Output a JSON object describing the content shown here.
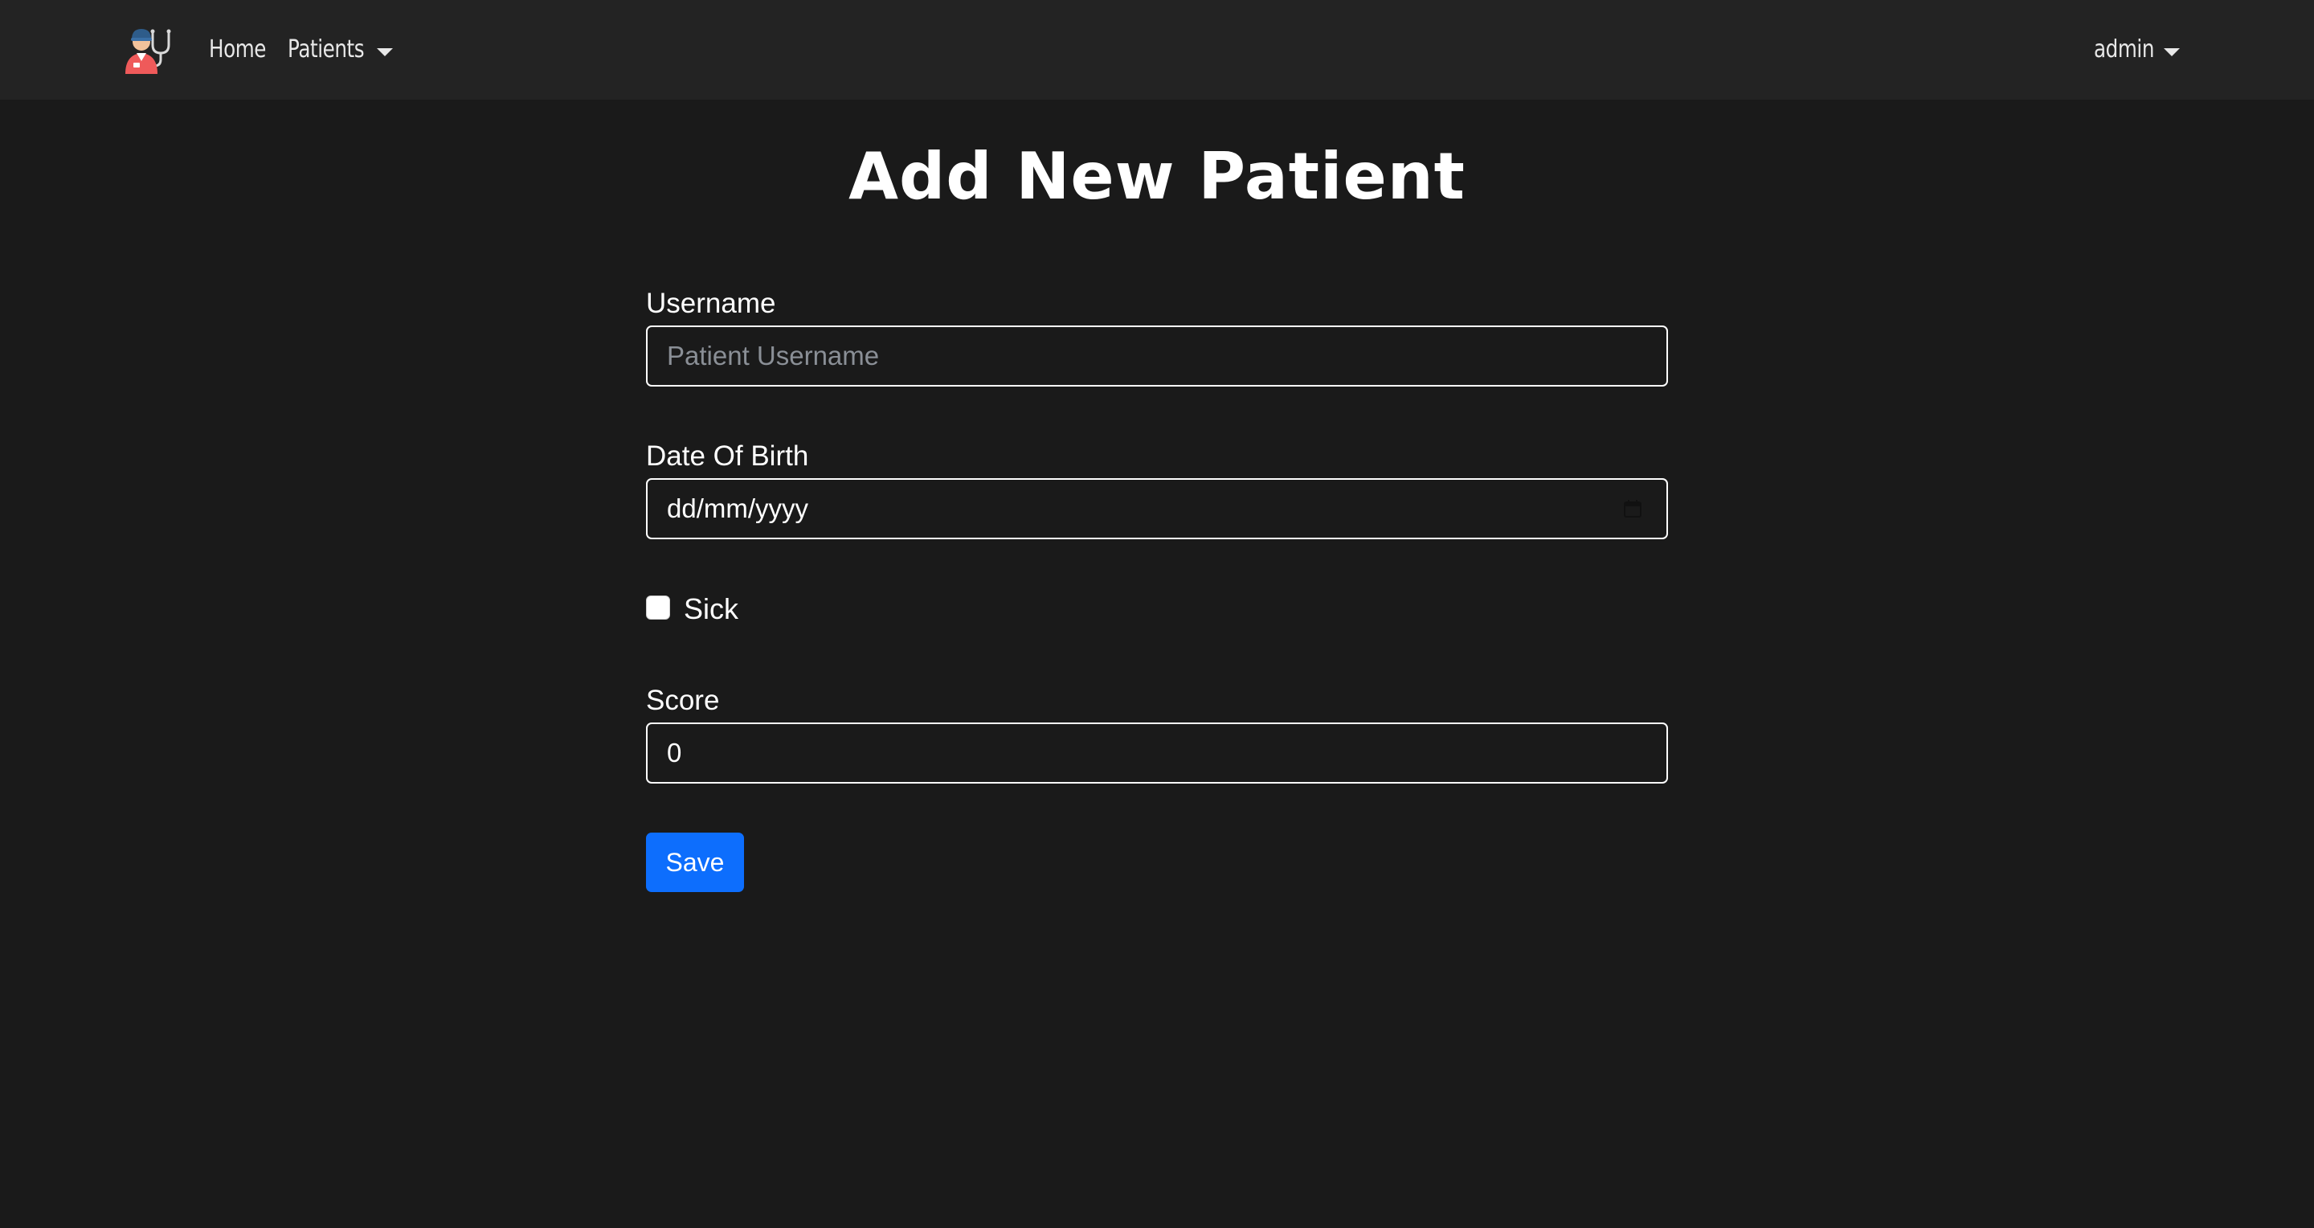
{
  "navbar": {
    "logo_icon": "doctor-avatar-icon",
    "home_label": "Home",
    "patients_label": "Patients",
    "user_label": "admin"
  },
  "page": {
    "title": "Add New Patient"
  },
  "form": {
    "username": {
      "label": "Username",
      "placeholder": "Patient Username",
      "value": ""
    },
    "dob": {
      "label": "Date Of Birth",
      "display": "dd/mm/yyyy"
    },
    "sick": {
      "label": "Sick",
      "checked": false
    },
    "score": {
      "label": "Score",
      "value": "0"
    },
    "save_label": "Save"
  },
  "colors": {
    "background": "#1a1a1a",
    "navbar": "#232323",
    "primary": "#0d6efd"
  }
}
